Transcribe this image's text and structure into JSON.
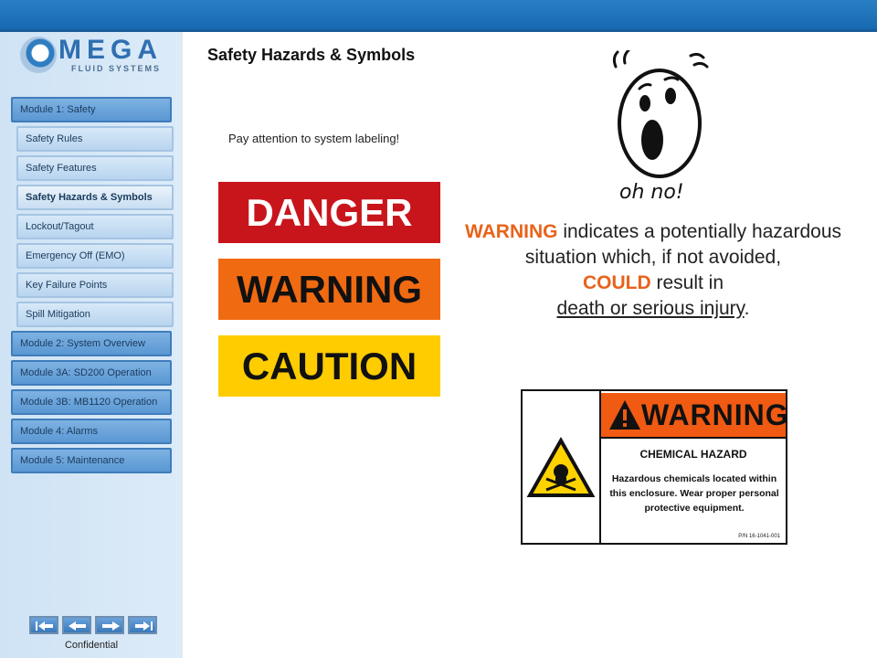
{
  "brand": {
    "name": "MEGA",
    "subtitle": "FLUID SYSTEMS",
    "primary_color": "#2f6fb0"
  },
  "page_title": "Safety Hazards & Symbols",
  "sidebar": {
    "items": [
      {
        "label": "Module 1: Safety",
        "kind": "module"
      },
      {
        "label": "Safety Rules",
        "kind": "sub"
      },
      {
        "label": "Safety Features",
        "kind": "sub"
      },
      {
        "label": "Safety Hazards & Symbols",
        "kind": "sub",
        "active": true
      },
      {
        "label": "Lockout/Tagout",
        "kind": "sub"
      },
      {
        "label": "Emergency Off (EMO)",
        "kind": "sub"
      },
      {
        "label": "Key Failure Points",
        "kind": "sub"
      },
      {
        "label": "Spill Mitigation",
        "kind": "sub"
      },
      {
        "label": "Module 2: System Overview",
        "kind": "module"
      },
      {
        "label": "Module 3A: SD200 Operation",
        "kind": "module"
      },
      {
        "label": "Module 3B: MB1120 Operation",
        "kind": "module"
      },
      {
        "label": "Module 4: Alarms",
        "kind": "module"
      },
      {
        "label": "Module 5: Maintenance",
        "kind": "module"
      }
    ]
  },
  "nav_controls": [
    "first-icon",
    "previous-icon",
    "next-icon",
    "last-icon"
  ],
  "footer": {
    "confidential": "Confidential"
  },
  "main": {
    "note": "Pay attention to system labeling!",
    "signs": {
      "danger": "DANGER",
      "warning": "WARNING",
      "caution": "CAUTION"
    },
    "message": {
      "part1": "WARNING",
      "part2": " indicates a potentially hazardous situation which, if not avoided,",
      "part3": "COULD",
      "part4": " result in",
      "part5": "death or serious injury",
      "part6": "."
    },
    "face_caption": "oh no!",
    "label": {
      "header": "WARNING",
      "title": "CHEMICAL HAZARD",
      "body": "Hazardous chemicals located within this enclosure. Wear proper personal protective equipment.",
      "part_number": "P/N 16-1041-001"
    }
  },
  "colors": {
    "danger": "#c8151b",
    "warning": "#f06a12",
    "caution": "#ffcc00",
    "accent_text": "#e8631b"
  }
}
